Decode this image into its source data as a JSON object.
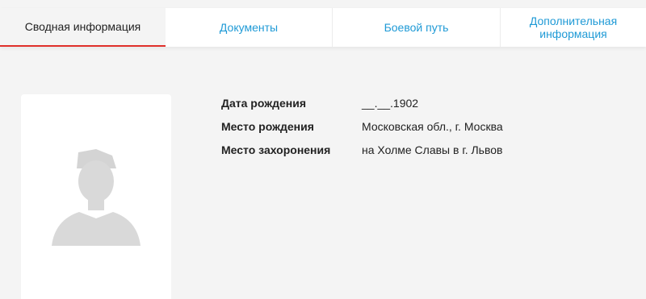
{
  "tabs": [
    {
      "label": "Сводная информация",
      "active": true
    },
    {
      "label": "Документы",
      "active": false
    },
    {
      "label": "Боевой путь",
      "active": false
    },
    {
      "label": "Дополнительная информация",
      "active": false
    }
  ],
  "photo": {
    "icon": "soldier-silhouette-placeholder",
    "silhouette_color": "#d9d9d9"
  },
  "info": {
    "birth_date_label": "Дата рождения",
    "birth_date_value": "__.__.1902",
    "birth_place_label": "Место рождения",
    "birth_place_value": "Московская обл., г. Москва",
    "burial_place_label": "Место захоронения",
    "burial_place_value": "на Холме Славы в г. Львов"
  },
  "colors": {
    "accent": "#1f9ad6",
    "active_underline": "#e0302b",
    "background": "#f4f4f4"
  }
}
